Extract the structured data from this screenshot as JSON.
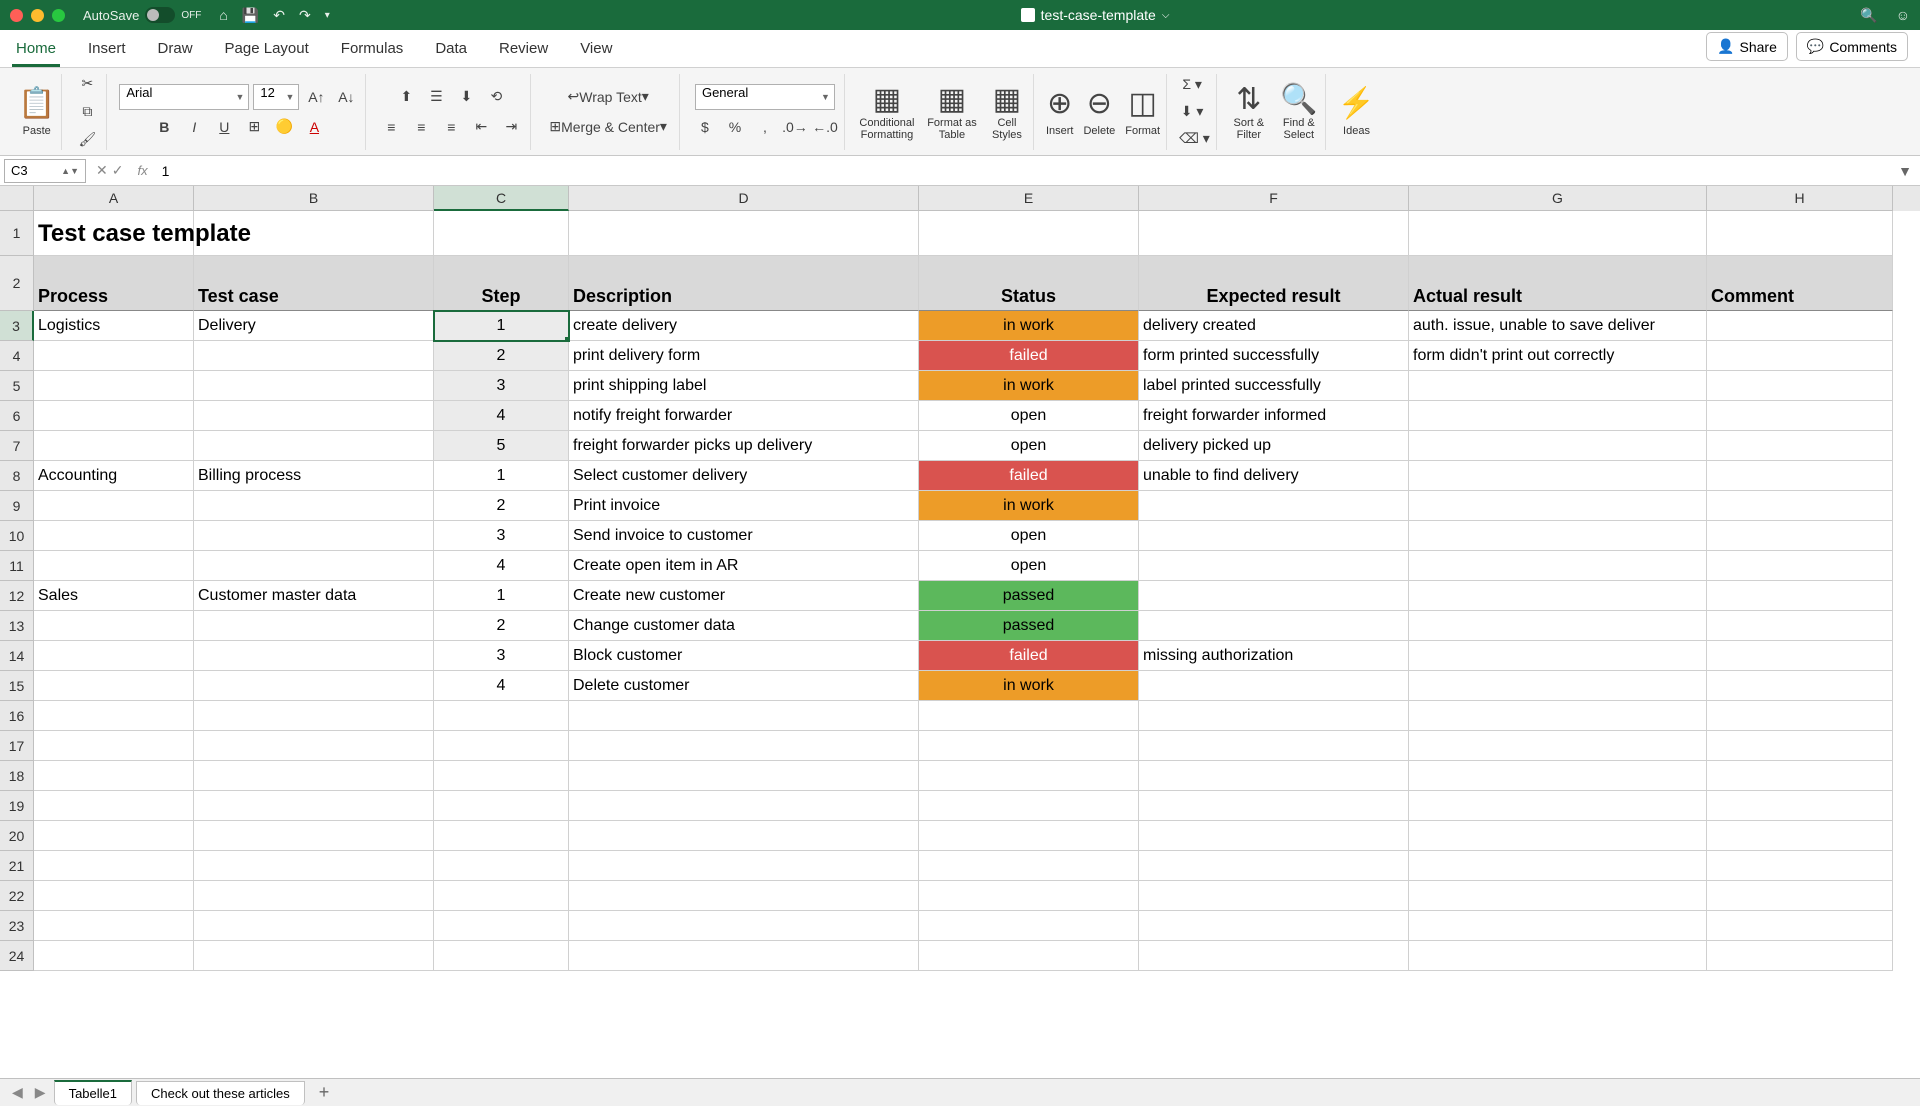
{
  "titlebar": {
    "autosave_label": "AutoSave",
    "autosave_state": "OFF",
    "filename": "test-case-template"
  },
  "ribbon_tabs": [
    "Home",
    "Insert",
    "Draw",
    "Page Layout",
    "Formulas",
    "Data",
    "Review",
    "View"
  ],
  "ribbon_active": "Home",
  "share_label": "Share",
  "comments_label": "Comments",
  "ribbon": {
    "paste": "Paste",
    "font_name": "Arial",
    "font_size": "12",
    "wrap": "Wrap Text",
    "merge": "Merge & Center",
    "number_format": "General",
    "cond": "Conditional Formatting",
    "fmt_table": "Format as Table",
    "cell_styles": "Cell Styles",
    "insert": "Insert",
    "delete": "Delete",
    "format": "Format",
    "sort": "Sort & Filter",
    "find": "Find & Select",
    "ideas": "Ideas"
  },
  "formula_bar": {
    "cell_ref": "C3",
    "fx": "fx",
    "content": "1"
  },
  "columns": [
    "A",
    "B",
    "C",
    "D",
    "E",
    "F",
    "G",
    "H"
  ],
  "title_cell": "Test case template",
  "headers": [
    "Process",
    "Test case",
    "Step",
    "Description",
    "Status",
    "Expected result",
    "Actual result",
    "Comment"
  ],
  "rows": [
    {
      "r": 3,
      "process": "Logistics",
      "testcase": "Delivery",
      "step": "1",
      "desc": "create delivery",
      "status": "in work",
      "st": "work",
      "expected": "delivery created",
      "actual": "auth. issue, unable to save deliver",
      "comment": ""
    },
    {
      "r": 4,
      "process": "",
      "testcase": "",
      "step": "2",
      "desc": "print delivery form",
      "status": "failed",
      "st": "fail",
      "expected": "form printed successfully",
      "actual": "form didn't print out correctly",
      "comment": ""
    },
    {
      "r": 5,
      "process": "",
      "testcase": "",
      "step": "3",
      "desc": "print shipping label",
      "status": "in work",
      "st": "work",
      "expected": "label printed successfully",
      "actual": "",
      "comment": ""
    },
    {
      "r": 6,
      "process": "",
      "testcase": "",
      "step": "4",
      "desc": "notify freight forwarder",
      "status": "open",
      "st": "",
      "expected": "freight forwarder informed",
      "actual": "",
      "comment": ""
    },
    {
      "r": 7,
      "process": "",
      "testcase": "",
      "step": "5",
      "desc": "freight forwarder picks up delivery",
      "status": "open",
      "st": "",
      "expected": "delivery picked up",
      "actual": "",
      "comment": ""
    },
    {
      "r": 8,
      "process": "Accounting",
      "testcase": "Billing process",
      "step": "1",
      "desc": "Select customer delivery",
      "status": "failed",
      "st": "fail",
      "expected": "unable to find delivery",
      "actual": "",
      "comment": ""
    },
    {
      "r": 9,
      "process": "",
      "testcase": "",
      "step": "2",
      "desc": "Print invoice",
      "status": "in work",
      "st": "work",
      "expected": "",
      "actual": "",
      "comment": ""
    },
    {
      "r": 10,
      "process": "",
      "testcase": "",
      "step": "3",
      "desc": "Send invoice to customer",
      "status": "open",
      "st": "",
      "expected": "",
      "actual": "",
      "comment": ""
    },
    {
      "r": 11,
      "process": "",
      "testcase": "",
      "step": "4",
      "desc": "Create open item in AR",
      "status": "open",
      "st": "",
      "expected": "",
      "actual": "",
      "comment": ""
    },
    {
      "r": 12,
      "process": "Sales",
      "testcase": "Customer master data",
      "step": "1",
      "desc": "Create new customer",
      "status": "passed",
      "st": "pass",
      "expected": "",
      "actual": "",
      "comment": ""
    },
    {
      "r": 13,
      "process": "",
      "testcase": "",
      "step": "2",
      "desc": "Change customer data",
      "status": "passed",
      "st": "pass",
      "expected": "",
      "actual": "",
      "comment": ""
    },
    {
      "r": 14,
      "process": "",
      "testcase": "",
      "step": "3",
      "desc": "Block customer",
      "status": "failed",
      "st": "fail",
      "expected": "missing authorization",
      "actual": "",
      "comment": ""
    },
    {
      "r": 15,
      "process": "",
      "testcase": "",
      "step": "4",
      "desc": "Delete customer",
      "status": "in work",
      "st": "work",
      "expected": "",
      "actual": "",
      "comment": ""
    }
  ],
  "empty_rows": [
    16,
    17,
    18,
    19,
    20,
    21,
    22,
    23,
    24
  ],
  "selected_cell": "C3",
  "sheets": [
    "Tabelle1",
    "Check out these articles"
  ],
  "active_sheet": "Tabelle1"
}
